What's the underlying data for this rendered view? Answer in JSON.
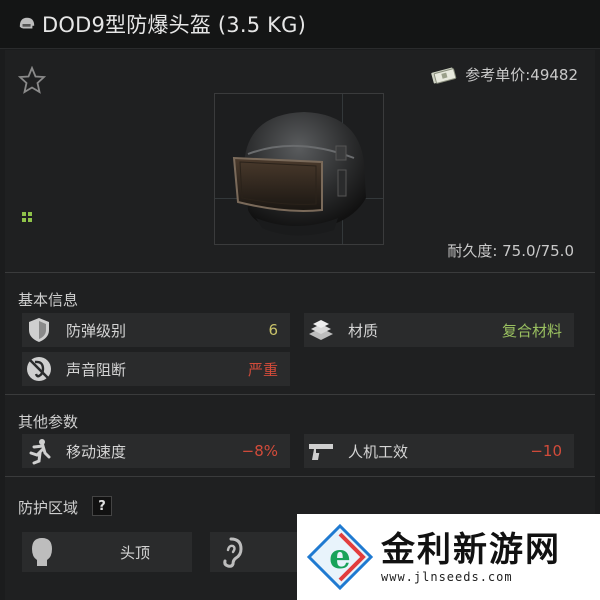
{
  "title_bar": {
    "title": "DOD9型防爆头盔 (3.5 KG)",
    "icon": "helmet-icon"
  },
  "item": {
    "price_label": "参考单价:49482",
    "price_icon": "money-icon",
    "favorite_icon": "star-icon",
    "durability_label": "耐久度: 75.0/75.0"
  },
  "basic_info": {
    "heading": "基本信息",
    "stats": [
      {
        "label": "防弹级别",
        "value": "6",
        "icon": "shield-icon",
        "value_color": "#c9c36a"
      },
      {
        "label": "材质",
        "value": "复合材料",
        "icon": "material-icon",
        "value_color": "#9ac060"
      },
      {
        "label": "声音阻断",
        "value": "严重",
        "icon": "sound-block-icon",
        "value_color": "#d24b3a"
      }
    ]
  },
  "other_params": {
    "heading": "其他参数",
    "stats": [
      {
        "label": "移动速度",
        "value": "−8%",
        "icon": "running-icon",
        "value_color": "#d24b3a"
      },
      {
        "label": "人机工效",
        "value": "−10",
        "icon": "pistol-icon",
        "value_color": "#d24b3a"
      }
    ]
  },
  "protection": {
    "heading": "防护区域",
    "help_label": "?",
    "zones": [
      {
        "label": "头顶",
        "icon": "head-top-icon"
      },
      {
        "label": "",
        "icon": "ear-icon"
      }
    ]
  },
  "watermark": {
    "brand": "金利新游网",
    "url": "www.jlnseeds.com"
  },
  "colors": {
    "background": "#1b1c1d",
    "stat_bg": "#2a2b2c",
    "positive": "#9ac060",
    "negative": "#d24b3a",
    "neutral_value": "#c9c36a"
  }
}
